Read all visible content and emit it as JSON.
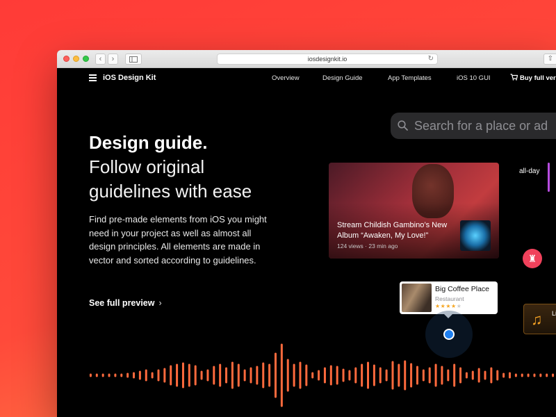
{
  "browser": {
    "url": "iosdesignkit.io",
    "back_icon": "chevron-left-icon",
    "forward_icon": "chevron-right-icon",
    "sidebar_icon": "sidebar-icon",
    "reload_icon": "reload-icon",
    "share_icon": "share-icon"
  },
  "nav": {
    "brand": "iOS Design Kit",
    "links": [
      "Overview",
      "Design Guide",
      "App Templates",
      "iOS 10 GUI"
    ],
    "buy": "Buy full vers"
  },
  "hero": {
    "title_bold": "Design guide.",
    "title_line2": "Follow original",
    "title_line3": "guidelines with ease",
    "description": "Find pre-made elements from iOS you might need in your project as well as almost all design principles. All elements are made in vector and sorted according to guidelines.",
    "cta": "See full preview",
    "cta_chevron": "›"
  },
  "search": {
    "placeholder": "Search for a place or ad"
  },
  "video": {
    "title": "Stream Childish Gambino’s New Album “Awaken, My Love!”",
    "meta": "124 views · 23 min ago"
  },
  "calendar": {
    "label": "all-day"
  },
  "place": {
    "name": "Big Coffee Place",
    "type": "Restaurant",
    "rating": 4,
    "max_rating": 5
  },
  "music": {
    "text": "Li"
  },
  "colors": {
    "background_top": "#ff3b37",
    "background_bottom": "#ff8a4a",
    "accent_wave": "#ff6a3d",
    "pin": "#f0415b",
    "location": "#1e7ff0",
    "calendar_bar": "#b74de0"
  }
}
